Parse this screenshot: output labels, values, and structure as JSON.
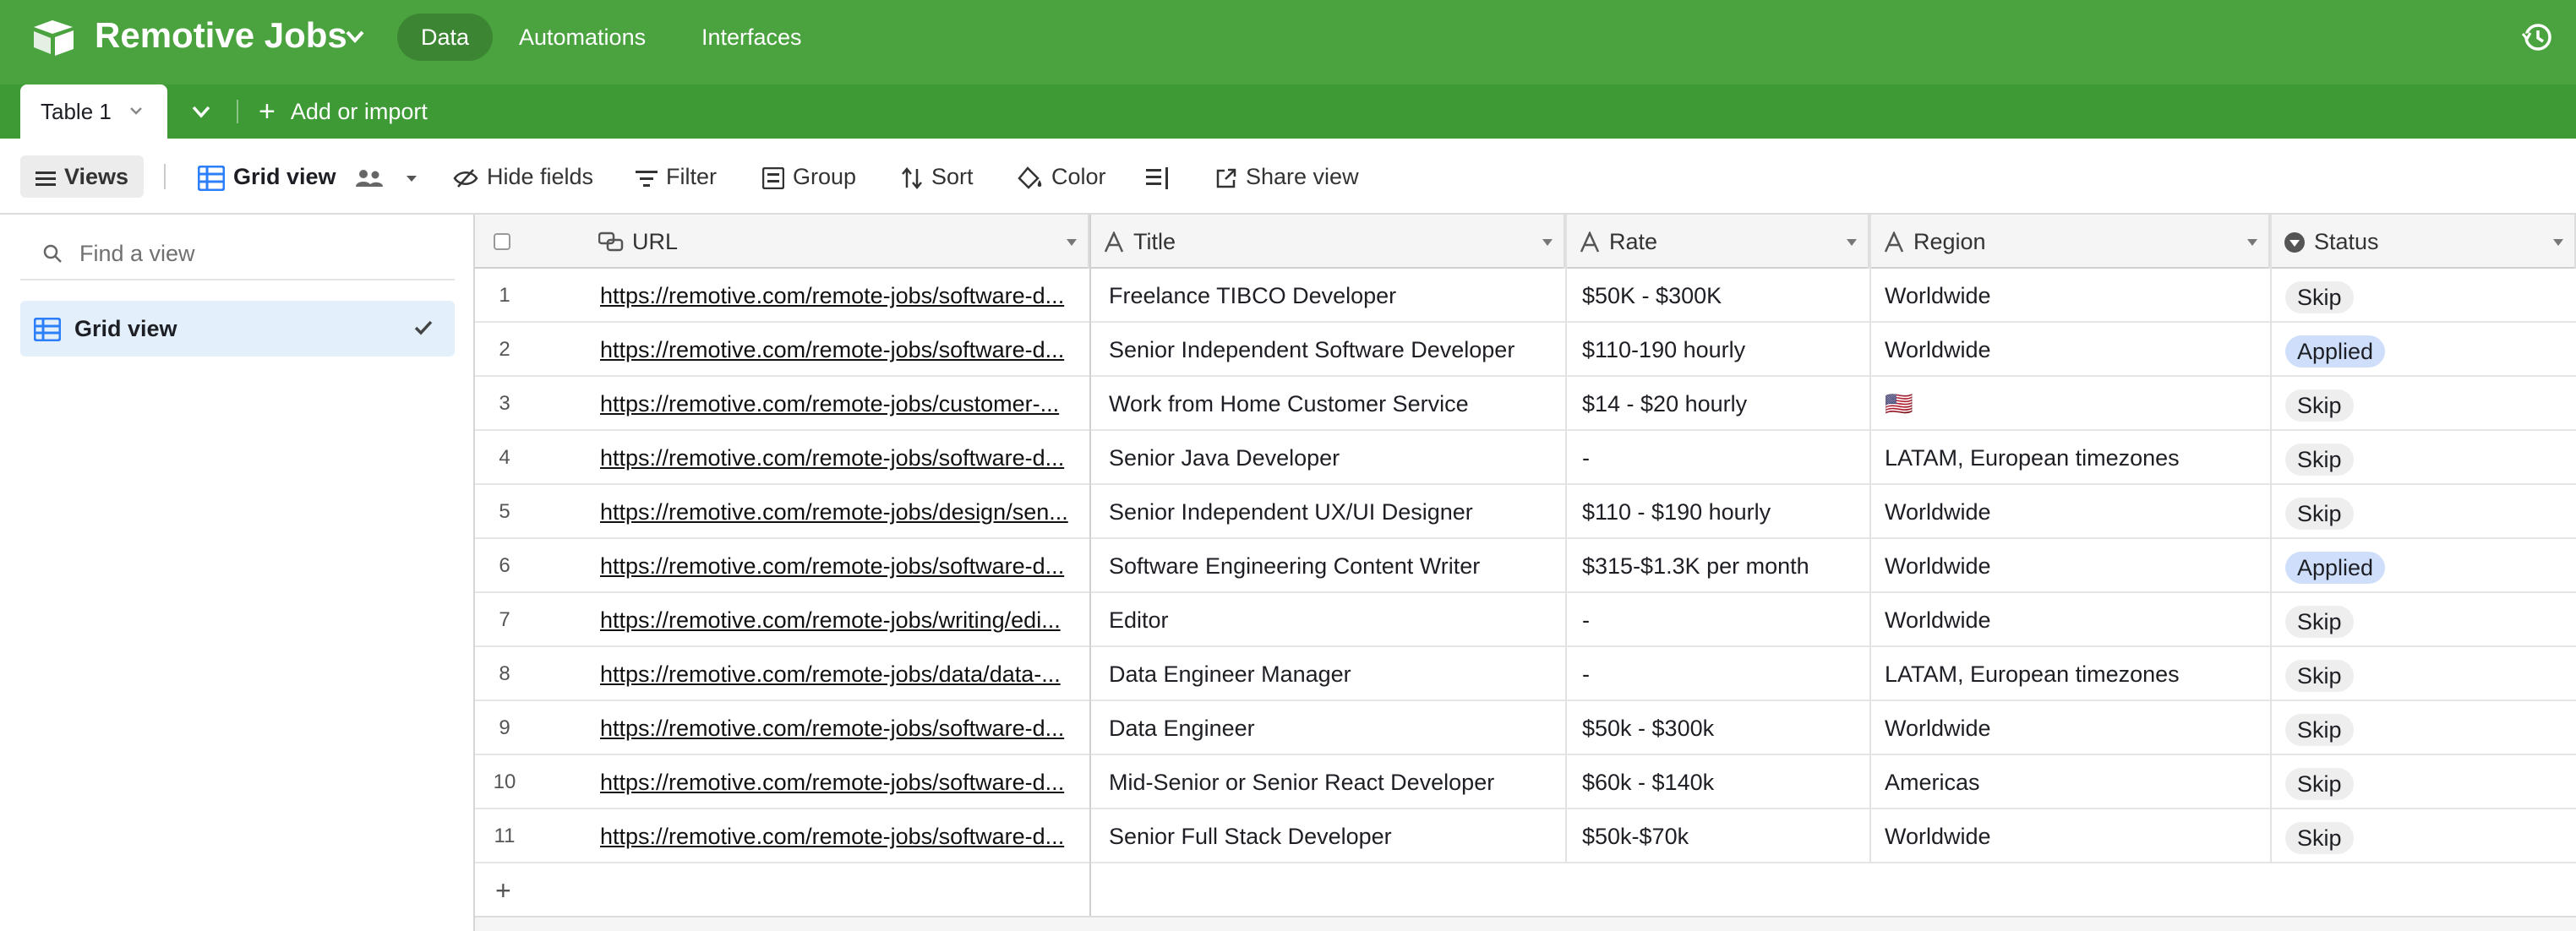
{
  "app": {
    "base_name": "Remotive Jobs",
    "nav": [
      "Data",
      "Automations",
      "Interfaces"
    ],
    "brand_color": "#4aa33f"
  },
  "tabbar": {
    "active_table": "Table 1",
    "add_import": "Add or import"
  },
  "toolbar": {
    "views": "Views",
    "grid_view": "Grid view",
    "hide_fields": "Hide fields",
    "filter": "Filter",
    "group": "Group",
    "sort": "Sort",
    "color": "Color",
    "share_view": "Share view"
  },
  "sidebar": {
    "find_placeholder": "Find a view",
    "view_item": "Grid view"
  },
  "columns": {
    "url": "URL",
    "title": "Title",
    "rate": "Rate",
    "region": "Region",
    "status": "Status"
  },
  "status_colors": {
    "Skip": "#eeeeee",
    "Applied": "#cfdffb"
  },
  "rows": [
    {
      "n": "1",
      "url": "https://remotive.com/remote-jobs/software-d...",
      "title": "Freelance TIBCO Developer",
      "rate": "$50K - $300K",
      "region": "Worldwide",
      "status": "Skip"
    },
    {
      "n": "2",
      "url": "https://remotive.com/remote-jobs/software-d...",
      "title": "Senior Independent Software Developer",
      "rate": "$110-190 hourly",
      "region": "Worldwide",
      "status": "Applied"
    },
    {
      "n": "3",
      "url": "https://remotive.com/remote-jobs/customer-...",
      "title": "Work from Home Customer Service",
      "rate": "$14 - $20 hourly",
      "region": "🇺🇸",
      "status": "Skip"
    },
    {
      "n": "4",
      "url": "https://remotive.com/remote-jobs/software-d...",
      "title": "Senior Java Developer",
      "rate": "-",
      "region": "LATAM, European timezones",
      "status": "Skip"
    },
    {
      "n": "5",
      "url": "https://remotive.com/remote-jobs/design/sen...",
      "title": "Senior Independent UX/UI Designer",
      "rate": "$110 - $190 hourly",
      "region": "Worldwide",
      "status": "Skip"
    },
    {
      "n": "6",
      "url": "https://remotive.com/remote-jobs/software-d...",
      "title": "Software Engineering Content Writer",
      "rate": "$315-$1.3K per month",
      "region": "Worldwide",
      "status": "Applied"
    },
    {
      "n": "7",
      "url": "https://remotive.com/remote-jobs/writing/edi...",
      "title": "Editor",
      "rate": "-",
      "region": "Worldwide",
      "status": "Skip"
    },
    {
      "n": "8",
      "url": "https://remotive.com/remote-jobs/data/data-...",
      "title": "Data Engineer Manager",
      "rate": "-",
      "region": "LATAM, European timezones",
      "status": "Skip"
    },
    {
      "n": "9",
      "url": "https://remotive.com/remote-jobs/software-d...",
      "title": "Data Engineer",
      "rate": "$50k - $300k",
      "region": "Worldwide",
      "status": "Skip"
    },
    {
      "n": "10",
      "url": "https://remotive.com/remote-jobs/software-d...",
      "title": "Mid-Senior or Senior React Developer",
      "rate": "$60k - $140k",
      "region": "Americas",
      "status": "Skip"
    },
    {
      "n": "11",
      "url": "https://remotive.com/remote-jobs/software-d...",
      "title": "Senior Full Stack Developer",
      "rate": "$50k-$70k",
      "region": "Worldwide",
      "status": "Skip"
    }
  ]
}
